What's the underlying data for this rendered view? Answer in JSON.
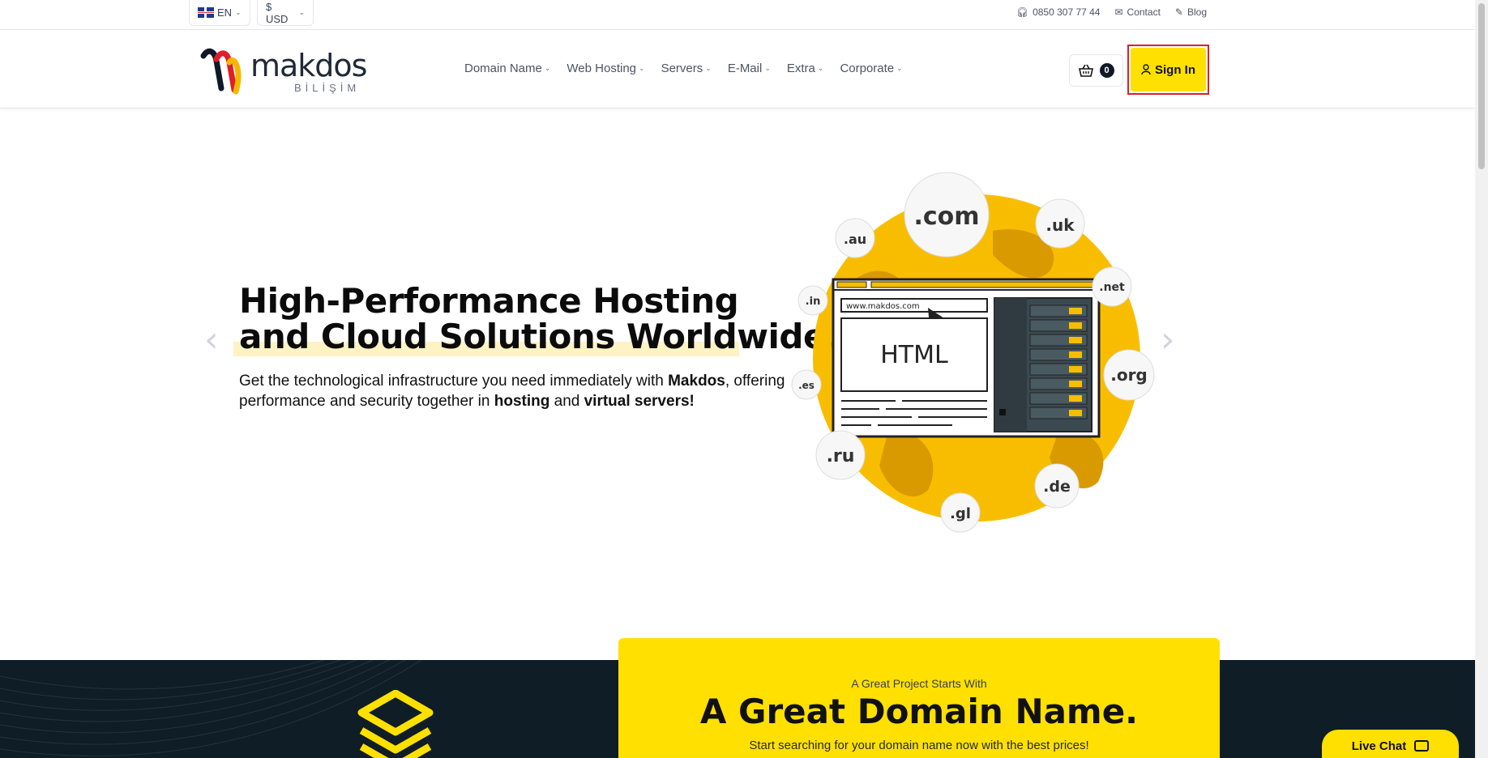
{
  "topbar": {
    "language": "EN",
    "currency": "$ USD",
    "phone": "0850 307 77 44",
    "contact": "Contact",
    "blog": "Blog"
  },
  "brand": {
    "name": "makdos",
    "sub": "BİLİŞİM"
  },
  "nav": {
    "items": [
      {
        "label": "Domain Name"
      },
      {
        "label": "Web Hosting"
      },
      {
        "label": "Servers"
      },
      {
        "label": "E-Mail"
      },
      {
        "label": "Extra"
      },
      {
        "label": "Corporate"
      }
    ]
  },
  "cart": {
    "count": "0"
  },
  "signin": {
    "label": "Sign In"
  },
  "hero": {
    "title_line1": "High-Performance Hosting",
    "title_line2": "and Cloud Solutions Worldwide",
    "desc_part1": "Get the technological infrastructure you need immediately with ",
    "desc_bold1": "Makdos",
    "desc_part2": ", offering performance and security together in ",
    "desc_bold2": "hosting",
    "desc_part3": " and ",
    "desc_bold3": "virtual servers!",
    "prev": "‹",
    "next": "›"
  },
  "illustration": {
    "tlds": [
      ".com",
      ".uk",
      ".au",
      ".net",
      ".in",
      ".org",
      ".es",
      ".ru",
      ".de",
      ".gl"
    ],
    "url": "www.makdos.com",
    "html_label": "HTML"
  },
  "domain_search": {
    "kicker": "A Great Project Starts With",
    "headline": "A Great Domain Name.",
    "subtext": "Start searching for your domain name now with the best prices!"
  },
  "livechat": {
    "label": "Live Chat"
  },
  "colors": {
    "accent": "#ffe000",
    "dark_section": "#0f1d26",
    "highlight": "#e11d2a"
  }
}
